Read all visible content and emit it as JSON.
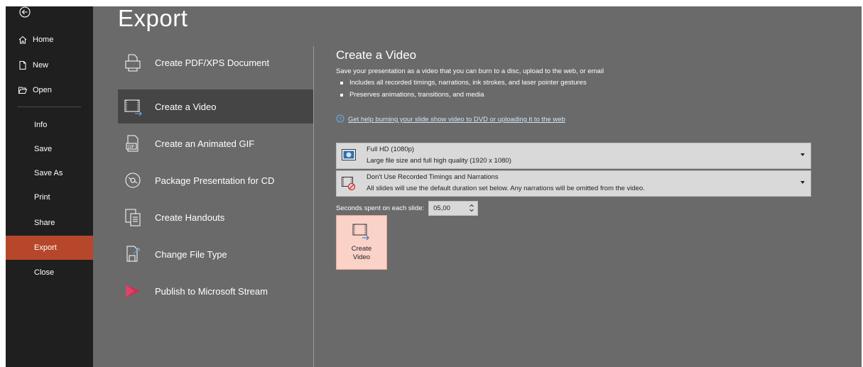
{
  "nav": {
    "items": [
      {
        "label": "Home",
        "icon": "home-icon"
      },
      {
        "label": "New",
        "icon": "new-document-icon"
      },
      {
        "label": "Open",
        "icon": "folder-open-icon"
      },
      {
        "label": "Info"
      },
      {
        "label": "Save"
      },
      {
        "label": "Save As"
      },
      {
        "label": "Print"
      },
      {
        "label": "Share"
      },
      {
        "label": "Export",
        "active": true
      },
      {
        "label": "Close"
      }
    ]
  },
  "page": {
    "title": "Export"
  },
  "export_options": [
    {
      "label": "Create PDF/XPS Document",
      "icon": "pdf-document-icon"
    },
    {
      "label": "Create a Video",
      "icon": "video-icon",
      "selected": true
    },
    {
      "label": "Create an Animated GIF",
      "icon": "gif-icon"
    },
    {
      "label": "Package Presentation for CD",
      "icon": "cd-icon"
    },
    {
      "label": "Create Handouts",
      "icon": "handouts-icon"
    },
    {
      "label": "Change File Type",
      "icon": "change-file-type-icon"
    },
    {
      "label": "Publish to Microsoft Stream",
      "icon": "microsoft-stream-icon"
    }
  ],
  "video_panel": {
    "title": "Create a Video",
    "description": "Save your presentation as a video that you can burn to a disc, upload to the web, or email",
    "bullets": [
      "Includes all recorded timings, narrations, ink strokes, and laser pointer gestures",
      "Preserves animations, transitions, and media"
    ],
    "help_link": "Get help burning your slide show video to DVD or uploading it to the web",
    "quality": {
      "title": "Full HD (1080p)",
      "subtitle": "Large file size and full high quality (1920 x 1080)"
    },
    "timings": {
      "title": "Don't Use Recorded Timings and Narrations",
      "subtitle": "All slides will use the default duration set below. Any narrations will be omitted from the video."
    },
    "seconds_label": "Seconds spent on each slide:",
    "seconds_value": "05,00",
    "create_button": {
      "line1": "Create",
      "line2": "Video"
    }
  },
  "colors": {
    "nav_bg": "#1f1f1f",
    "content_bg": "#6a6a6a",
    "active_nav": "#b7472a",
    "selected_option": "#454545",
    "create_button_bg": "#fad2c8"
  }
}
